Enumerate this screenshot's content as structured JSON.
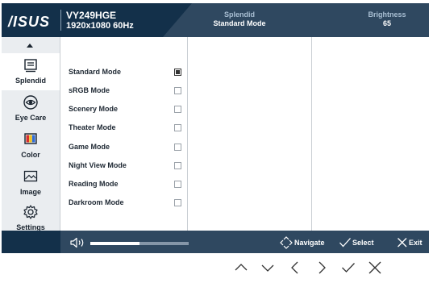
{
  "header": {
    "brand": "/ISUS",
    "model": "VY249HGE",
    "resolution": "1920x1080 60Hz",
    "splendid_label": "Splendid",
    "splendid_value": "Standard Mode",
    "brightness_label": "Brightness",
    "brightness_value": "65"
  },
  "sidebar": {
    "items": [
      {
        "label": "Splendid",
        "icon": "splendid-icon",
        "active": true
      },
      {
        "label": "Eye Care",
        "icon": "eye-icon",
        "active": false
      },
      {
        "label": "Color",
        "icon": "color-icon",
        "active": false
      },
      {
        "label": "Image",
        "icon": "image-icon",
        "active": false
      },
      {
        "label": "Settings",
        "icon": "gear-icon",
        "active": false
      }
    ]
  },
  "modes": [
    {
      "label": "Standard Mode",
      "checked": true
    },
    {
      "label": "sRGB Mode",
      "checked": false
    },
    {
      "label": "Scenery Mode",
      "checked": false
    },
    {
      "label": "Theater Mode",
      "checked": false
    },
    {
      "label": "Game Mode",
      "checked": false
    },
    {
      "label": "Night View Mode",
      "checked": false
    },
    {
      "label": "Reading Mode",
      "checked": false
    },
    {
      "label": "Darkroom Mode",
      "checked": false
    }
  ],
  "footer": {
    "volume_fraction": 0.5,
    "navigate_label": "Navigate",
    "select_label": "Select",
    "exit_label": "Exit"
  },
  "nav_keys": [
    "chevron-up-icon",
    "chevron-down-icon",
    "chevron-left-icon",
    "chevron-right-icon",
    "check-icon",
    "close-icon"
  ],
  "colors": {
    "header_dark": "#13304a",
    "header_panel": "#2f4860",
    "sidebar_bg": "#eaedf0"
  }
}
